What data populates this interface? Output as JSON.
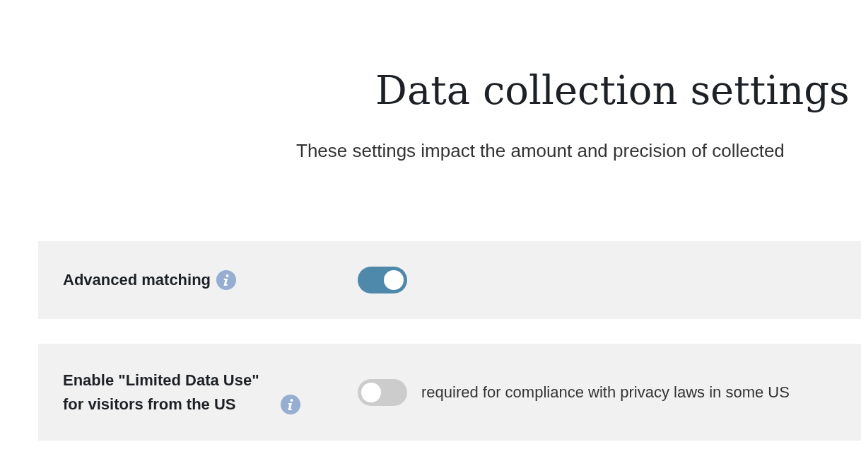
{
  "title": "Data collection settings",
  "subtitle": "These settings impact the amount and precision of collected",
  "settings": [
    {
      "label": "Advanced matching",
      "on": true
    },
    {
      "label": "Enable \"Limited Data Use\" for visitors from the US",
      "on": false,
      "description": "required for compliance with privacy laws in some US"
    }
  ]
}
